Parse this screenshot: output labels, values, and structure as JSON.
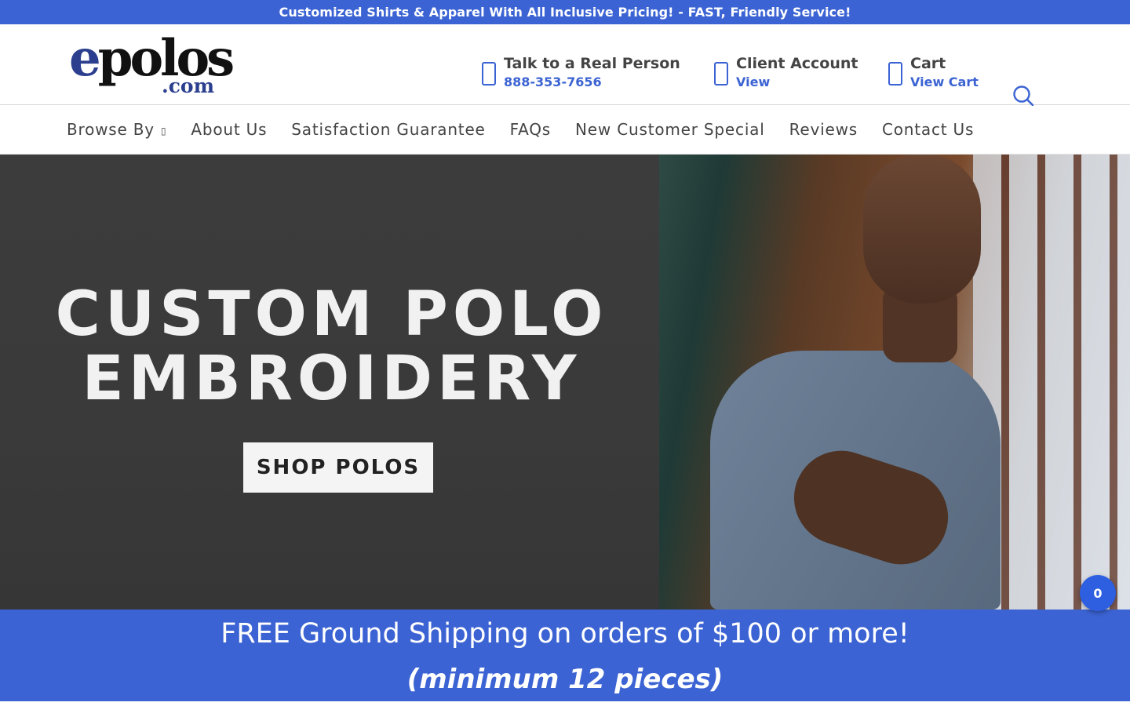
{
  "announcement": "Customized Shirts & Apparel With All Inclusive Pricing! - FAST, Friendly Service!",
  "logo": {
    "word_e": "e",
    "word_rest": "polos",
    "dotcom": ".com"
  },
  "header": {
    "phone": {
      "title": "Talk to a Real Person",
      "subtitle": "888-353-7656",
      "icon": "phone-icon"
    },
    "account": {
      "title": "Client Account",
      "subtitle": "View",
      "icon": "user-icon"
    },
    "cart": {
      "title": "Cart",
      "subtitle": "View Cart",
      "icon": "cart-icon"
    },
    "search_icon": "search-icon"
  },
  "nav": {
    "browse": "Browse By",
    "caret": "▯",
    "about": "About Us",
    "guarantee": "Satisfaction Guarantee",
    "faqs": "FAQs",
    "special": "New Customer Special",
    "reviews": "Reviews",
    "contact": "Contact Us"
  },
  "hero": {
    "line1": "CUSTOM POLO",
    "line2": "EMBROIDERY",
    "button": "SHOP POLOS"
  },
  "shipping": {
    "line1": "FREE Ground Shipping on orders of $100 or more!",
    "line2": "(minimum 12 pieces)"
  },
  "cart_badge": "0",
  "colors": {
    "accent": "#3b63d3",
    "badge": "#2d5fe0"
  }
}
